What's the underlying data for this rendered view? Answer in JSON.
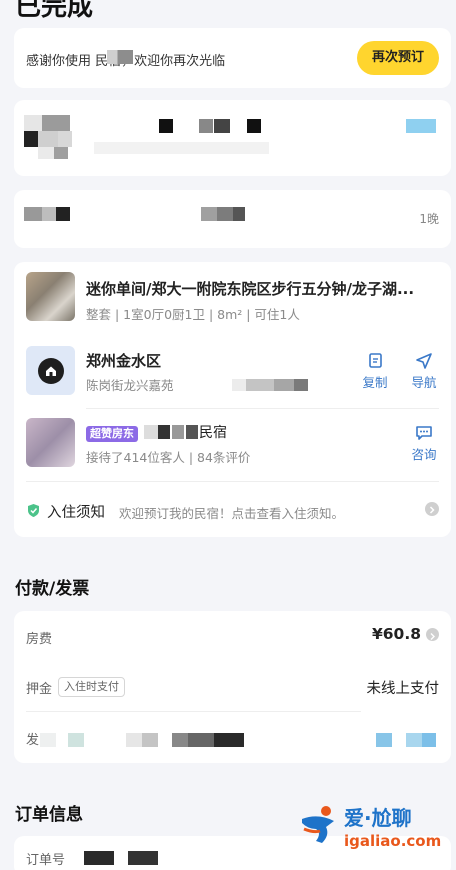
{
  "header": {
    "status_title": "已完成"
  },
  "thanks_card": {
    "message": "感谢你使用 民宿，欢迎你再次光临",
    "rebook_label": "再次预订"
  },
  "stay_card": {
    "nights": "1晚"
  },
  "listing": {
    "title": "迷你单间/郑大一附院东院区步行五分钟/龙子湖...",
    "details": "整套 | 1室0厅0厨1卫 | 8m² | 可住1人",
    "district": "郑州金水区",
    "street": "陈岗街龙兴嘉苑",
    "copy_label": "复制",
    "navigate_label": "导航",
    "host_badge": "超赞房东",
    "host_name": "民宿",
    "host_stats": "接待了414位客人 | 84条评价",
    "consult_label": "咨询",
    "notice_label": "入住须知",
    "notice_text": "欢迎预订我的民宿！点击查看入住须知。"
  },
  "payment": {
    "section_title": "付款/发票",
    "room_fee_label": "房费",
    "room_fee_value": "¥60.8",
    "deposit_label": "押金",
    "deposit_tag": "入住时支付",
    "deposit_value": "未线上支付",
    "invoice_label": "发"
  },
  "order": {
    "section_title": "订单信息",
    "order_no_label": "订单号"
  },
  "watermark": {
    "brand": "爱·尬聊",
    "url": "igaliao.com"
  },
  "colors": {
    "accent_yellow": "#ffd52e",
    "link_blue": "#3a78c8",
    "badge_purple": "#8c6ae6",
    "notice_green": "#4cc38a"
  }
}
